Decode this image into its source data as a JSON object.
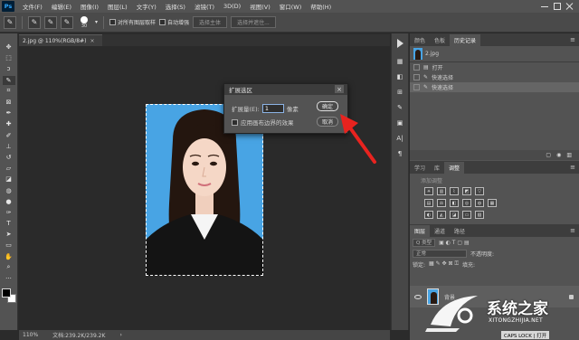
{
  "app": {
    "logo_text": "Ps"
  },
  "menubar": {
    "items": [
      "文件(F)",
      "编辑(E)",
      "图像(I)",
      "图层(L)",
      "文字(Y)",
      "选择(S)",
      "滤镜(T)",
      "3D(D)",
      "视图(V)",
      "窗口(W)",
      "帮助(H)"
    ]
  },
  "options": {
    "brush_size": "30",
    "sample_all_layers": "对所有图层取样",
    "auto_enhance": "自动增强",
    "select_subject": "选择主体",
    "select_and_mask": "选择并遮住..."
  },
  "document": {
    "tab_title": "2.jpg @ 110%(RGB/8#)",
    "zoom": "110%",
    "doc_info": "文档:239.2K/239.2K"
  },
  "dialog": {
    "title": "扩展选区",
    "expand_label": "扩展量(E):",
    "expand_value": "1",
    "unit": "像素",
    "apply_canvas_bounds": "应用画布边界的效果",
    "ok_label": "确定",
    "cancel_label": "取消"
  },
  "history_panel": {
    "tabs": [
      "颜色",
      "色板",
      "历史记录"
    ],
    "active_tab": "历史记录",
    "snapshot_name": "2.jpg",
    "states": [
      "打开",
      "快速选择",
      "快速选择"
    ]
  },
  "adjustments_panel": {
    "tabs": [
      "学习",
      "库",
      "调整"
    ],
    "active_tab": "调整",
    "title": "添加调整"
  },
  "layers_panel": {
    "tabs": [
      "图层",
      "通道",
      "路径"
    ],
    "active_tab": "图层",
    "kind_filter": "Q 类型",
    "blend_mode": "正常",
    "opacity_label": "不透明度:",
    "lock_label": "锁定:",
    "fill_label": "填充:",
    "layer_name": "背景"
  },
  "watermark": {
    "brand": "系统之家",
    "url": "XITONGZHIJIA.NET",
    "status": "CAPS LOCK | 打开"
  },
  "colors": {
    "photo_background": "#48a4e4",
    "arrow": "#e8231f"
  }
}
